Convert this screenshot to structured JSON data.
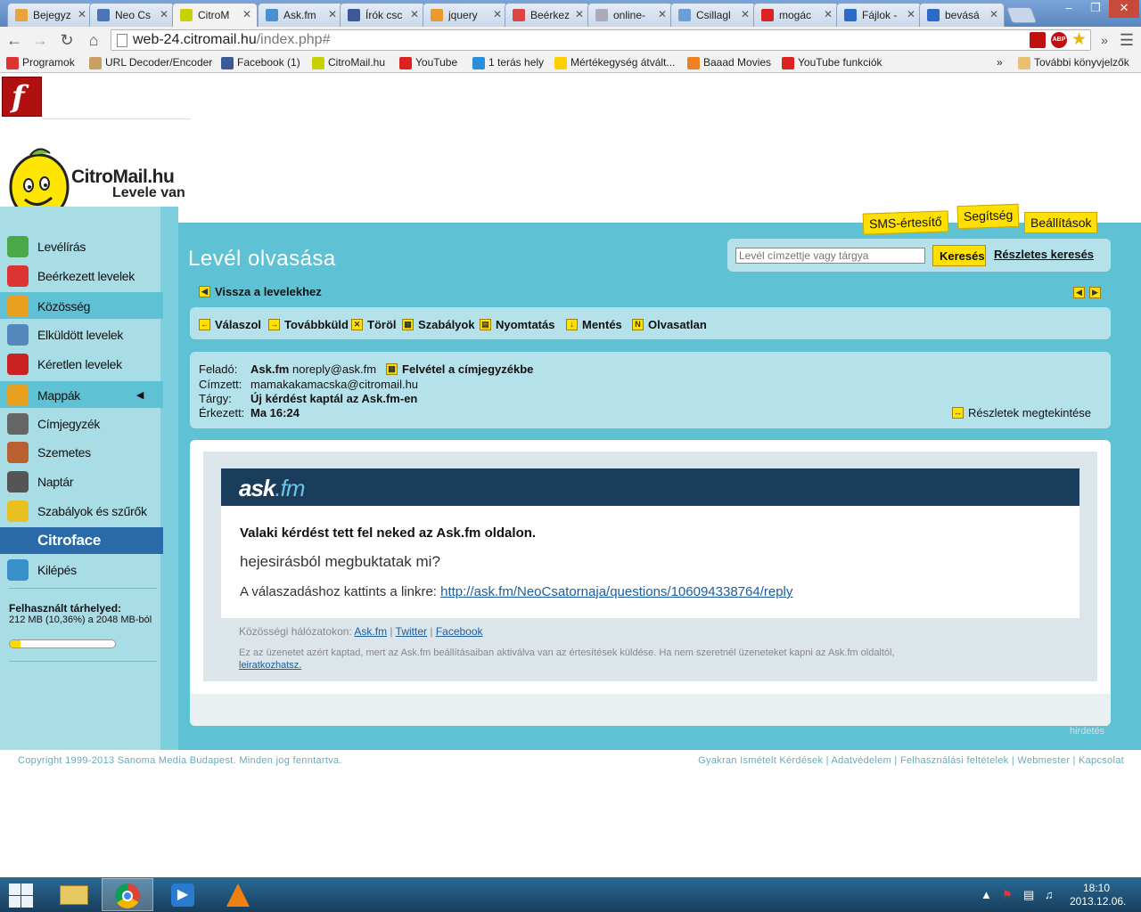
{
  "browser": {
    "tabs": [
      {
        "label": "Bejegyz",
        "color": "#e8a33c"
      },
      {
        "label": "Neo Cs",
        "color": "#4a76b8"
      },
      {
        "label": "CitroM",
        "color": "#c8d200"
      },
      {
        "label": "Ask.fm",
        "color": "#4a8fd0"
      },
      {
        "label": "Írók csc",
        "color": "#3b5998"
      },
      {
        "label": "jquery",
        "color": "#e89a2c"
      },
      {
        "label": "Beérkez",
        "color": "#d44"
      },
      {
        "label": "online-",
        "color": "#aab"
      },
      {
        "label": "Csillagl",
        "color": "#6a9fd8"
      },
      {
        "label": "mogác",
        "color": "#d22"
      },
      {
        "label": "Fájlok -",
        "color": "#2a6bc8"
      },
      {
        "label": "bevásá",
        "color": "#2a6bc8"
      }
    ],
    "url_host": "web-24.citromail.hu",
    "url_path": "/index.php#",
    "bookmarks": [
      {
        "label": "Programok",
        "color": "#d33"
      },
      {
        "label": "URL Decoder/Encoder",
        "color": "#c8a060"
      },
      {
        "label": "Facebook (1)",
        "color": "#3b5998"
      },
      {
        "label": "CitroMail.hu",
        "color": "#c8d200"
      },
      {
        "label": "YouTube",
        "color": "#d22"
      },
      {
        "label": "1 terás hely",
        "color": "#2a8fd8"
      },
      {
        "label": "Mértékegység átvált...",
        "color": "#ffd000"
      },
      {
        "label": "Baaad Movies",
        "color": "#f08020"
      },
      {
        "label": "YouTube funkciók",
        "color": "#d22"
      }
    ],
    "bookmarks_more": "»",
    "other_bookmarks": "További könyvjelzők"
  },
  "logo": {
    "name": "CitroMail.hu",
    "slogan": "Levele van"
  },
  "top_tabs": [
    "SMS-értesítő",
    "Segítség",
    "Beállítások"
  ],
  "sidebar": {
    "items": [
      {
        "label": "Levélírás",
        "color": "#4aa84a"
      },
      {
        "label": "Beérkezett levelek",
        "color": "#d33"
      },
      {
        "label": "Közösség",
        "color": "#e8a020"
      },
      {
        "label": "Elküldött levelek",
        "color": "#5588bb"
      },
      {
        "label": "Kéretlen levelek",
        "color": "#cc2222"
      },
      {
        "label": "Mappák",
        "color": "#e8a020"
      },
      {
        "label": "Címjegyzék",
        "color": "#666"
      },
      {
        "label": "Szemetes",
        "color": "#b86030"
      },
      {
        "label": "Naptár",
        "color": "#555"
      },
      {
        "label": "Szabályok és szűrők",
        "color": "#e8c020"
      },
      {
        "label": "Citroface",
        "color": "#2a6aa8"
      },
      {
        "label": "Kilépés",
        "color": "#3a90c8"
      }
    ],
    "quota_label": "Felhasznált tárhelyed:",
    "quota_value": "212 MB (10,36%) a 2048 MB-ból",
    "quota_fraction": 0.1036
  },
  "main": {
    "title": "Levél olvasása",
    "search_placeholder": "Levél címzettje vagy tárgya",
    "search_button": "Keresés",
    "advanced_search": "Részletes keresés",
    "back_link": "Vissza a levelekhez",
    "actions": [
      "Válaszol",
      "Továbbküld",
      "Töröl",
      "Szabályok",
      "Nyomtatás",
      "Mentés",
      "Olvasatlan"
    ],
    "header": {
      "from_label": "Feladó:",
      "from_name": "Ask.fm",
      "from_email": "noreply@ask.fm",
      "add_contact": "Felvétel a címjegyzékbe",
      "to_label": "Címzett:",
      "to_value": "mamakakamacska@citromail.hu",
      "subject_label": "Tárgy:",
      "subject_value": "Új kérdést kaptál az Ask.fm-en",
      "received_label": "Érkezett:",
      "received_value": "Ma 16:24",
      "details": "Részletek megtekintése"
    },
    "message": {
      "logo_ask": "ask",
      "logo_fm": ".fm",
      "line1": "Valaki kérdést tett fel neked az Ask.fm oldalon.",
      "question": "hejesirásból megbuktatak mi?",
      "reply_prefix": "A válaszadáshoz kattints a linkre: ",
      "reply_link": "http://ask.fm/NeoCsatornaja/questions/106094338764/reply",
      "social_prefix": "Közösségi hálózatokon: ",
      "social_links": [
        "Ask.fm",
        "Twitter",
        "Facebook"
      ],
      "disclaimer": "Ez az üzenetet azért kaptad, mert az Ask.fm beállításaiban aktiválva van az értesítések küldése. Ha nem szeretnél üzeneteket kapni az Ask.fm oldaltól,",
      "unsubscribe": "leiratkozhatsz."
    },
    "ad_label": "hirdetés"
  },
  "footer": {
    "copyright": "Copyright 1999-2013 Sanoma Media Budapest. Minden jog fenntartva.",
    "links": [
      "Gyakran Ismételt Kérdések",
      "Adatvédelem",
      "Felhasználási feltételek",
      "Webmester",
      "Kapcsolat"
    ]
  },
  "taskbar": {
    "time": "18:10",
    "date": "2013.12.06."
  },
  "colors": {
    "accent_yellow": "#ffe000",
    "teal": "#5ec2d4",
    "light_teal": "#b5e2ea",
    "askfm_header": "#1b3d5c"
  }
}
